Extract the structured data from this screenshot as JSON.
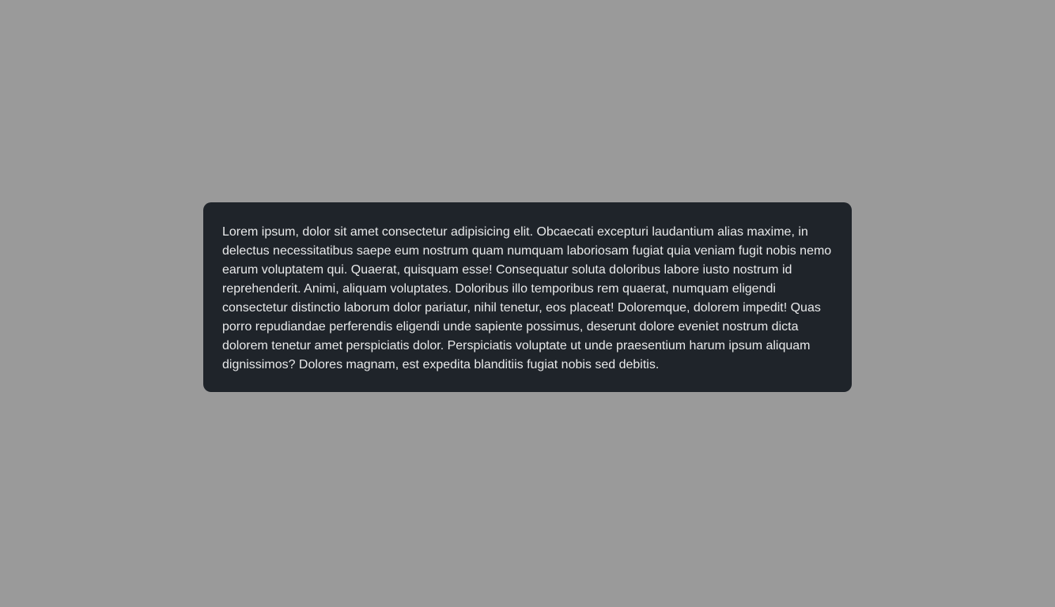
{
  "colors": {
    "overlay_background": "#9a9a9a",
    "modal_background": "#1f242a",
    "modal_text": "#e8e9ea"
  },
  "modal": {
    "body_text": "Lorem ipsum, dolor sit amet consectetur adipisicing elit. Obcaecati excepturi laudantium alias maxime, in delectus necessitatibus saepe eum nostrum quam numquam laboriosam fugiat quia veniam fugit nobis nemo earum voluptatem qui. Quaerat, quisquam esse! Consequatur soluta doloribus labore iusto nostrum id reprehenderit. Animi, aliquam voluptates. Doloribus illo temporibus rem quaerat, numquam eligendi consectetur distinctio laborum dolor pariatur, nihil tenetur, eos placeat! Doloremque, dolorem impedit! Quas porro repudiandae perferendis eligendi unde sapiente possimus, deserunt dolore eveniet nostrum dicta dolorem tenetur amet perspiciatis dolor. Perspiciatis voluptate ut unde praesentium harum ipsum aliquam dignissimos? Dolores magnam, est expedita blanditiis fugiat nobis sed debitis."
  }
}
